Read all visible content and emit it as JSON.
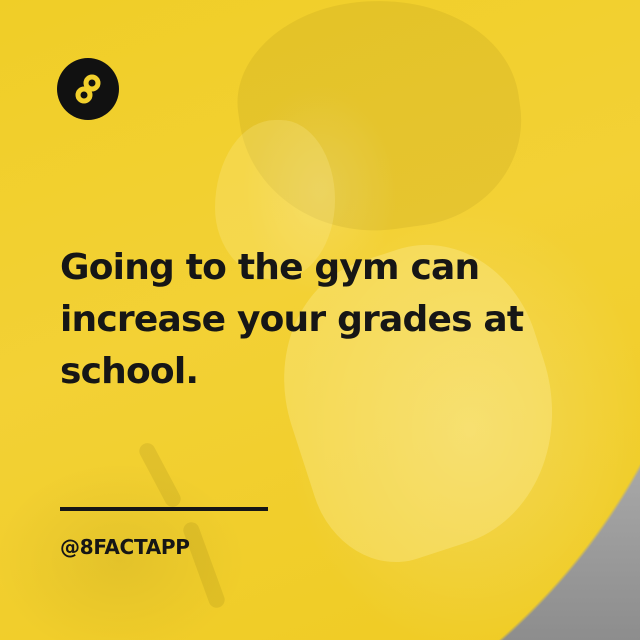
{
  "post": {
    "headline": "Going to the gym can increase your grades at school.",
    "handle": "@8FACTAPP"
  },
  "brand": {
    "logo_icon": "infinity-eight-icon",
    "accent_color": "#f2d02c",
    "logo_color": "#111111"
  }
}
